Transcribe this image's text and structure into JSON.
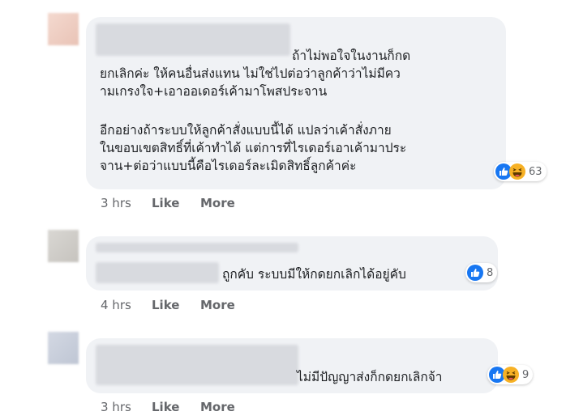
{
  "comments": [
    {
      "lines": [
        "ถ้าไม่พอใจในงานก็กด",
        "ยกเลิกค่ะ ให้คนอื่นส่งแทน ไม่ใช่ไปต่อว่าลูกค้าว่าไม่มีคว",
        "ามเกรงใจ+เอาออเดอร์เค้ามาโพสประจาน",
        "",
        "อีกอย่างถ้าระบบให้ลูกค้าสั่งแบบนี้ได้ แปลว่าเค้าสั่งภาย",
        "ในขอบเขตสิทธิ์ที่เค้าทำได้ แต่การที่ไรเดอร์เอาเค้ามาประ",
        "จาน+ต่อว่าแบบนี้คือไรเดอร์ละเมิดสิทธิ์ลูกค้าค่ะ"
      ],
      "reactions": [
        "like",
        "haha"
      ],
      "reaction_count": "63",
      "time": "3 hrs",
      "like_label": "Like",
      "more_label": "More"
    },
    {
      "lines": [
        "ถูกคับ ระบบมีให้กดยกเลิกได้อยู่คับ"
      ],
      "reactions": [
        "like"
      ],
      "reaction_count": "8",
      "time": "4 hrs",
      "like_label": "Like",
      "more_label": "More"
    },
    {
      "lines": [
        "ไม่มีปัญญาส่งก็กดยกเลิกจ้า"
      ],
      "reactions": [
        "like",
        "haha"
      ],
      "reaction_count": "9",
      "time": "3 hrs",
      "like_label": "Like",
      "more_label": "More"
    }
  ],
  "colors": {
    "bubble": "#f0f2f5",
    "meta_text": "#65676b",
    "like_blue": "#1877f2",
    "haha_yellow": "#f7b125"
  }
}
